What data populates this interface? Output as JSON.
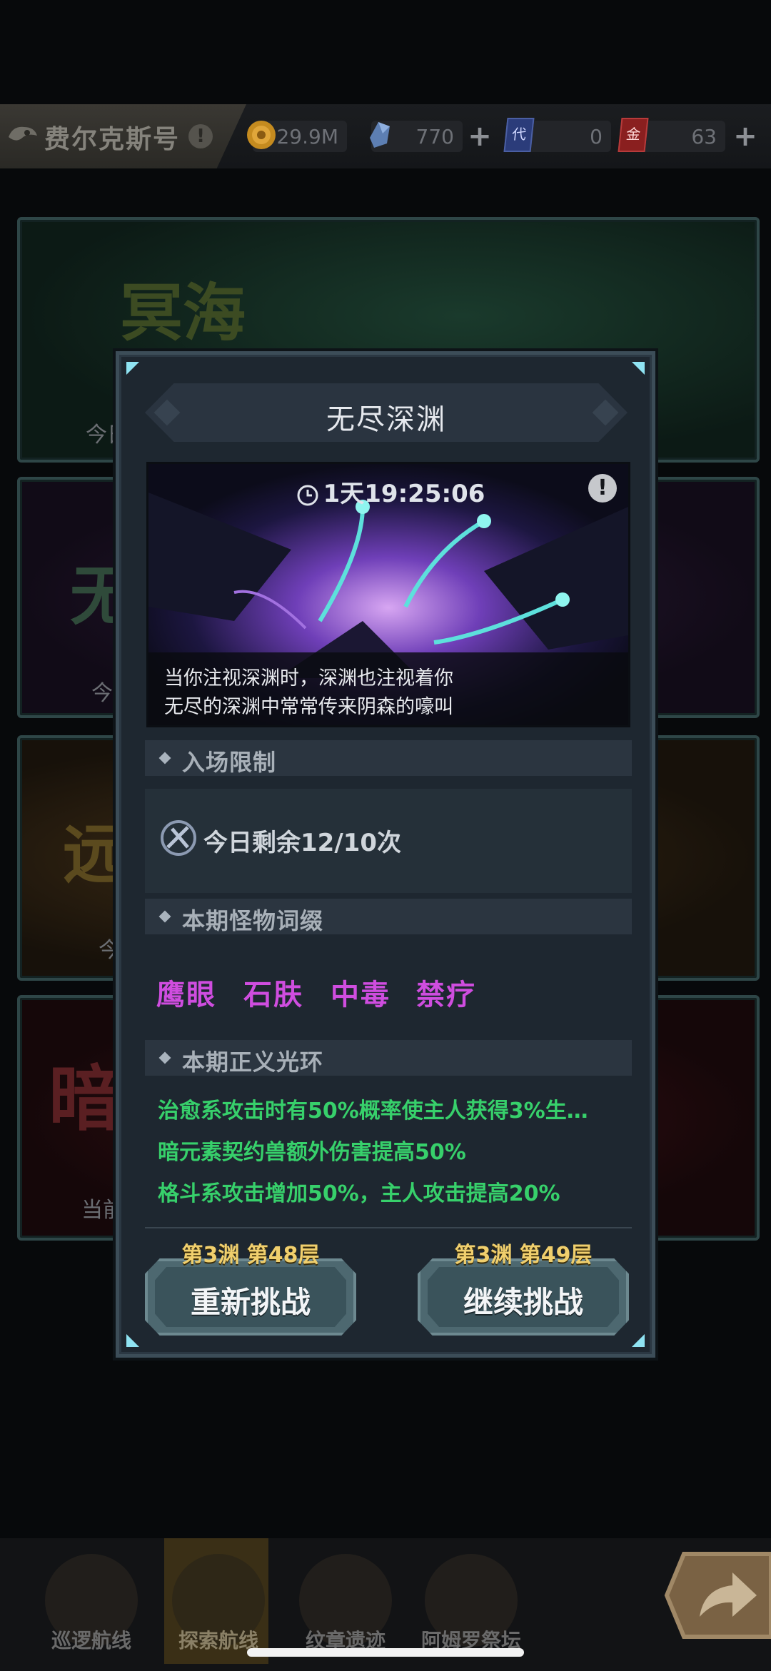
{
  "topbar": {
    "ship_name": "费尔克斯号",
    "ship_info_icon": "!",
    "gold": "29.9M",
    "crystal": "770",
    "ticket_a_icon_text": "代",
    "ticket_a": "0",
    "ticket_b_icon_text": "金",
    "ticket_b": "63",
    "plus": "+"
  },
  "background_cards": [
    {
      "art_text": "冥海",
      "partial_text": "今日"
    },
    {
      "art_text": "无",
      "partial_text": "今"
    },
    {
      "art_text": "远",
      "partial_text": "今"
    },
    {
      "art_text": "暗",
      "partial_text": "当前"
    }
  ],
  "modal": {
    "title": "无尽深渊",
    "timer": "1天19:25:06",
    "info_icon": "!",
    "caption_lines": [
      "当你注视深渊时，深渊也注视着你",
      "无尽的深渊中常常传来阴森的嚎叫"
    ],
    "entry_limit_header": "入场限制",
    "entry_limit_text": "今日剩余12/10次",
    "monster_affix_header": "本期怪物词缀",
    "affixes": [
      "鹰眼",
      "石肤",
      "中毒",
      "禁疗"
    ],
    "aura_header": "本期正义光环",
    "auras": [
      "治愈系攻击时有50%概率使主人获得3%生…",
      "暗元素契约兽额外伤害提高50%",
      "格斗系攻击增加50%，主人攻击提高20%"
    ],
    "retry": {
      "floor": "第3渊 第48层",
      "label": "重新挑战"
    },
    "continue": {
      "floor": "第3渊 第49层",
      "label": "继续挑战"
    }
  },
  "bottom_nav": [
    {
      "label": "巡逻航线",
      "active": false
    },
    {
      "label": "探索航线",
      "active": true
    },
    {
      "label": "纹章遗迹",
      "active": false
    },
    {
      "label": "阿姆罗祭坛",
      "active": false
    }
  ],
  "colors": {
    "affix": "#cf4ddf",
    "aura": "#37d06b",
    "floor_label": "#f0cf6d",
    "accent_cyan": "#8fe3f2"
  }
}
